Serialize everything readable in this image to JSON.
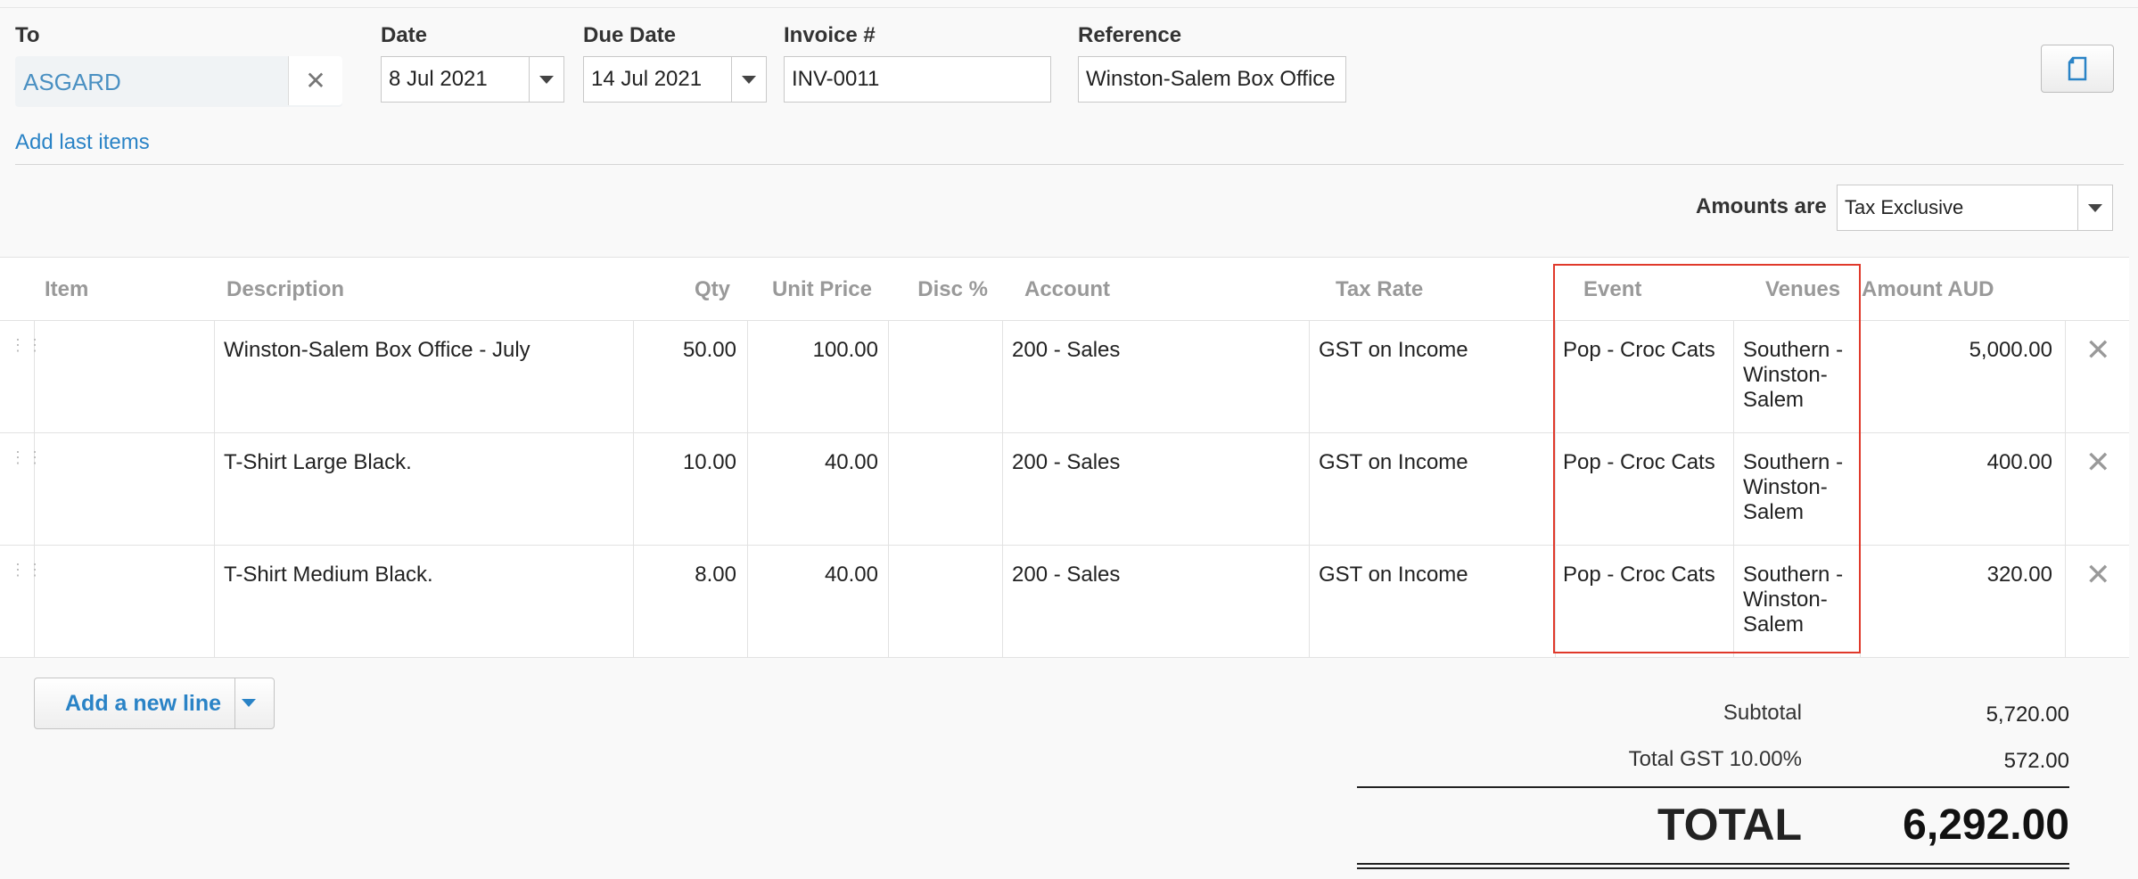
{
  "header": {
    "to_label": "To",
    "to_value": "ASGARD",
    "date_label": "Date",
    "date_value": "8 Jul 2021",
    "due_label": "Due Date",
    "due_value": "14 Jul 2021",
    "invoice_label": "Invoice #",
    "invoice_value": "INV-0011",
    "reference_label": "Reference",
    "reference_value": "Winston-Salem Box Office",
    "add_last_items": "Add last items"
  },
  "amounts": {
    "label": "Amounts are",
    "value": "Tax Exclusive"
  },
  "table": {
    "columns": [
      "Item",
      "Description",
      "Qty",
      "Unit Price",
      "Disc %",
      "Account",
      "Tax Rate",
      "Event",
      "Venues",
      "Amount AUD"
    ],
    "rows": [
      {
        "item": "",
        "description": "Winston-Salem Box Office - July",
        "qty": "50.00",
        "unit_price": "100.00",
        "disc": "",
        "account": "200 - Sales",
        "tax_rate": "GST on Income",
        "event": "Pop - Croc Cats",
        "venue_l1": "Southern -",
        "venue_l2": "Winston-",
        "venue_l3": "Salem",
        "amount": "5,000.00"
      },
      {
        "item": "",
        "description": "T-Shirt Large Black.",
        "qty": "10.00",
        "unit_price": "40.00",
        "disc": "",
        "account": "200 - Sales",
        "tax_rate": "GST on Income",
        "event": "Pop - Croc Cats",
        "venue_l1": "Southern -",
        "venue_l2": "Winston-",
        "venue_l3": "Salem",
        "amount": "400.00"
      },
      {
        "item": "",
        "description": "T-Shirt Medium Black.",
        "qty": "8.00",
        "unit_price": "40.00",
        "disc": "",
        "account": "200 - Sales",
        "tax_rate": "GST on Income",
        "event": "Pop - Croc Cats",
        "venue_l1": "Southern -",
        "venue_l2": "Winston-",
        "venue_l3": "Salem",
        "amount": "320.00"
      }
    ]
  },
  "add_line": "Add a new line",
  "totals": {
    "subtotal_label": "Subtotal",
    "subtotal_value": "5,720.00",
    "gst_label": "Total GST 10.00%",
    "gst_value": "572.00",
    "total_label": "TOTAL",
    "total_value": "6,292.00"
  },
  "colors": {
    "link": "#2a83c6",
    "highlight_border": "#e0392b"
  },
  "icons": {
    "clear": "close-icon",
    "dropdown": "caret-down-icon",
    "drag": "drag-handle-icon",
    "delete": "delete-row-icon",
    "copy": "copy-document-icon"
  }
}
